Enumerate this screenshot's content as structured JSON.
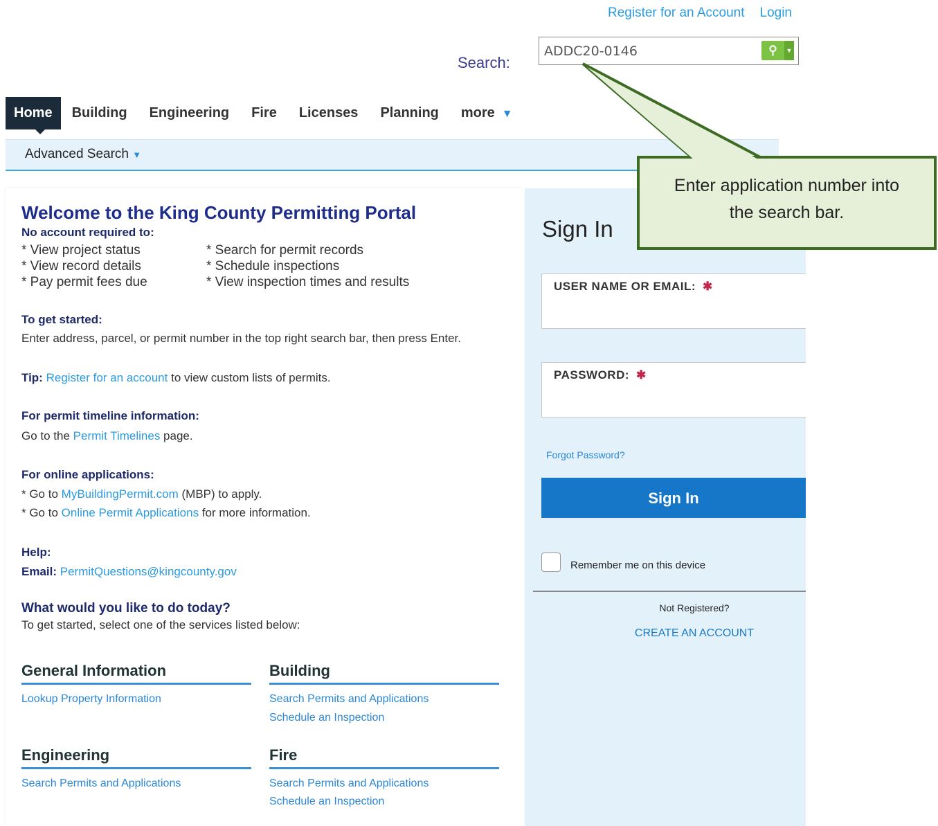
{
  "header": {
    "register_link": "Register for an Account",
    "login_link": "Login",
    "search_label": "Search:",
    "search_value": "ADDC20-0146"
  },
  "nav": {
    "items": [
      "Home",
      "Building",
      "Engineering",
      "Fire",
      "Licenses",
      "Planning",
      "more"
    ],
    "advanced_search": "Advanced Search"
  },
  "welcome": {
    "title": "Welcome to the King County Permitting Portal",
    "no_account": "No account required to:",
    "left_list": [
      "* View project status",
      "* View record details",
      "* Pay permit fees due"
    ],
    "right_list": [
      "* Search for permit records",
      "* Schedule inspections",
      "* View inspection times and results"
    ],
    "get_started_head": "To get started:",
    "get_started_text": "Enter address, parcel, or permit number in the top right search bar, then press Enter.",
    "tip_label": "Tip:",
    "tip_link": "Register for an account",
    "tip_rest": "to view custom lists of permits.",
    "timeline_head": "For permit timeline information:",
    "timeline_pre": "Go to the",
    "timeline_link": "Permit Timelines",
    "timeline_post": "page.",
    "online_head": "For online applications:",
    "online_1_pre": "* Go to",
    "online_1_link": "MyBuildingPermit.com",
    "online_1_post": "(MBP) to apply.",
    "online_2_pre": "* Go to",
    "online_2_link": "Online Permit Applications",
    "online_2_post": "for more information.",
    "help_head": "Help:",
    "email_label": "Email:",
    "email_link": "PermitQuestions@kingcounty.gov",
    "today_head": "What would you like to do today?",
    "today_text": "To get started, select one of the services listed below:"
  },
  "services": {
    "general": {
      "title": "General Information",
      "links": [
        "Lookup Property Information"
      ]
    },
    "building": {
      "title": "Building",
      "links": [
        "Search Permits and Applications",
        "Schedule an Inspection"
      ]
    },
    "engineering": {
      "title": "Engineering",
      "links": [
        "Search Permits and Applications"
      ]
    },
    "fire": {
      "title": "Fire",
      "links": [
        "Search Permits and Applications",
        "Schedule an Inspection"
      ]
    }
  },
  "signin": {
    "title": "Sign In",
    "username_label": "USER NAME OR EMAIL:",
    "password_label": "PASSWORD:",
    "required_mark": "✱",
    "forgot": "Forgot Password?",
    "button": "Sign In",
    "remember": "Remember me on this device",
    "not_registered": "Not Registered?",
    "create_account": "CREATE AN ACCOUNT"
  },
  "callout": {
    "text_line1": "Enter application number into",
    "text_line2": "the search bar."
  },
  "colors": {
    "nav_active_bg": "#1c2b39",
    "link": "#2b9be0",
    "signin_button": "#1677c9",
    "callout_fill": "#e6efd8",
    "callout_border": "#3d6b23",
    "search_button": "#7cc243"
  }
}
